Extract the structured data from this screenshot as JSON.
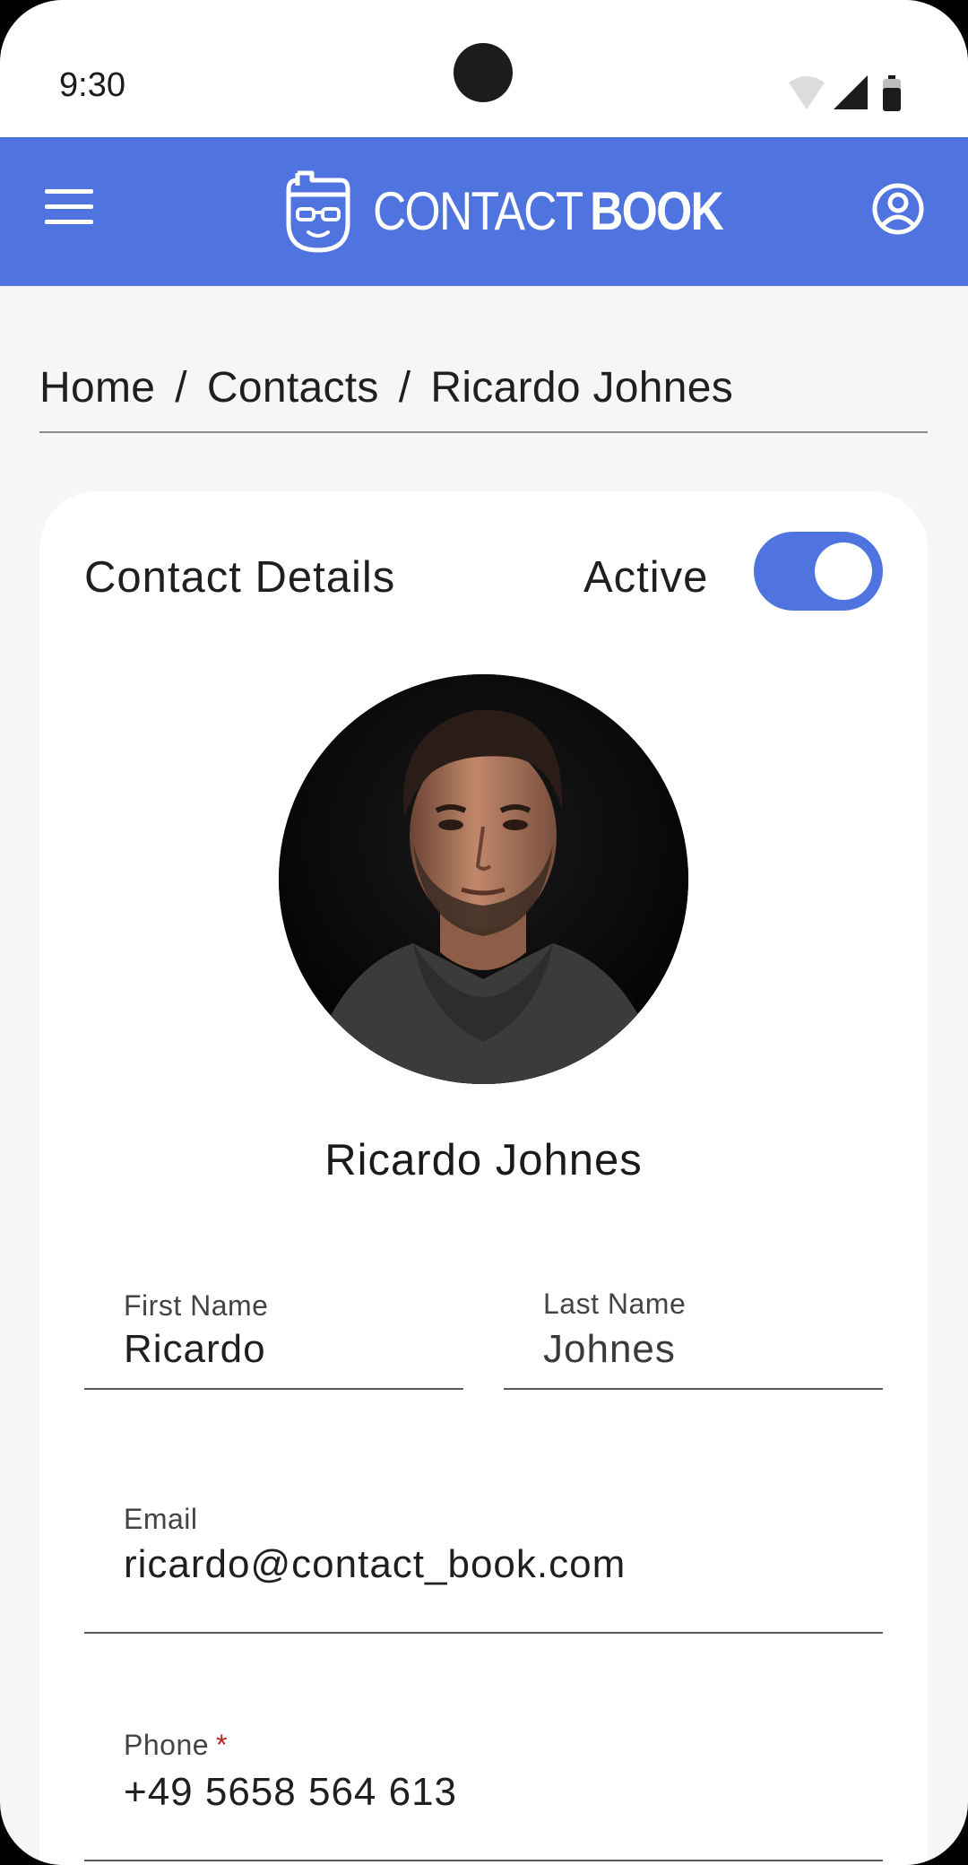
{
  "status_bar": {
    "time": "9:30",
    "icons": [
      "wifi-icon",
      "cellular-signal-icon",
      "battery-icon"
    ]
  },
  "app_bar": {
    "menu_icon": "hamburger-menu-icon",
    "logo": {
      "text_light": "CONTACT",
      "text_bold": "BOOK",
      "icon": "nerd-face-logo-icon"
    },
    "account_icon": "account-circle-icon",
    "background_color": "#4f73df"
  },
  "breadcrumb": {
    "items": [
      "Home",
      "Contacts",
      "Ricardo Johnes"
    ],
    "separator": "/"
  },
  "contact_card": {
    "title": "Contact Details",
    "active_label": "Active",
    "active": true,
    "name": "Ricardo Johnes",
    "fields": {
      "first_name": {
        "label": "First Name",
        "value": "Ricardo"
      },
      "last_name": {
        "label": "Last Name",
        "value": "Johnes"
      },
      "email": {
        "label": "Email",
        "value": "ricardo@contact_book.com"
      },
      "phone": {
        "label": "Phone",
        "required_marker": "*",
        "value": "+49 5658 564 613"
      }
    }
  }
}
